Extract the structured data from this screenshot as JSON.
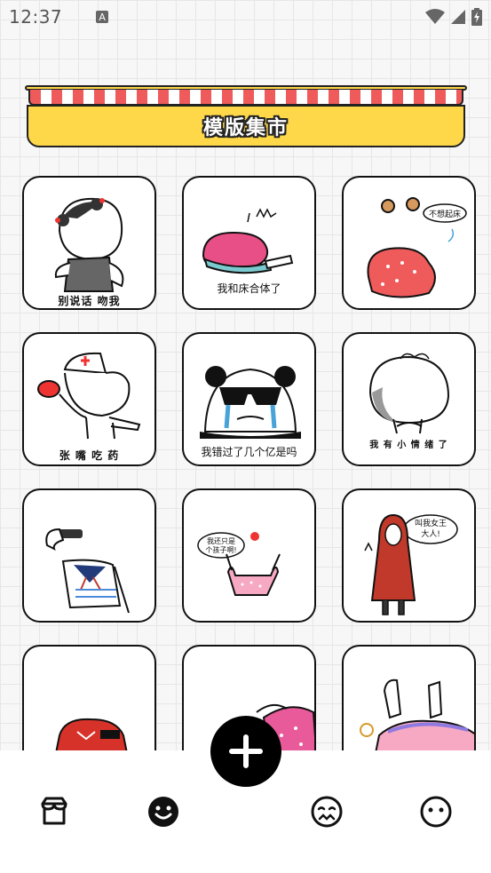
{
  "status_bar": {
    "time": "12:37",
    "notification_icon": "A",
    "icons": [
      "wifi-icon",
      "signal-icon",
      "battery-icon"
    ]
  },
  "banner": {
    "title": "模版集市"
  },
  "cards": [
    {
      "caption": "别说话 吻我",
      "icon": "girl-buns-sticker"
    },
    {
      "caption": "我和床合体了",
      "icon": "lying-under-blanket-sticker"
    },
    {
      "caption": "不想起床",
      "icon": "curled-blanket-sticker"
    },
    {
      "caption": "张 嘴 吃 药",
      "icon": "nurse-pill-sticker"
    },
    {
      "caption": "我错过了几个亿是吗",
      "icon": "crying-panda-sticker"
    },
    {
      "caption": "我 有 小 情 绪 了",
      "icon": "sulking-head-sticker"
    },
    {
      "caption": "",
      "icon": "salute-sailor-sticker"
    },
    {
      "caption": "我还只是个孩子啊!",
      "icon": "child-pink-shirt-sticker"
    },
    {
      "caption": "叫我女王大人!",
      "icon": "red-hood-queen-sticker"
    },
    {
      "caption": "",
      "icon": "red-sweater-sticker"
    },
    {
      "caption": "",
      "icon": "pink-pillow-sticker"
    },
    {
      "caption": "",
      "icon": "bed-clock-sticker"
    }
  ],
  "fab": {
    "icon": "plus-icon"
  },
  "bottom_nav": [
    {
      "icon": "store-icon",
      "active": false
    },
    {
      "icon": "smiley-icon",
      "active": true
    },
    {
      "icon": "sad-face-icon",
      "active": false
    },
    {
      "icon": "neutral-face-icon",
      "active": false
    }
  ],
  "colors": {
    "banner_yellow": "#ffd84a",
    "awning_red": "#ef5b5b",
    "ink": "#111111",
    "fab": "#000000"
  }
}
